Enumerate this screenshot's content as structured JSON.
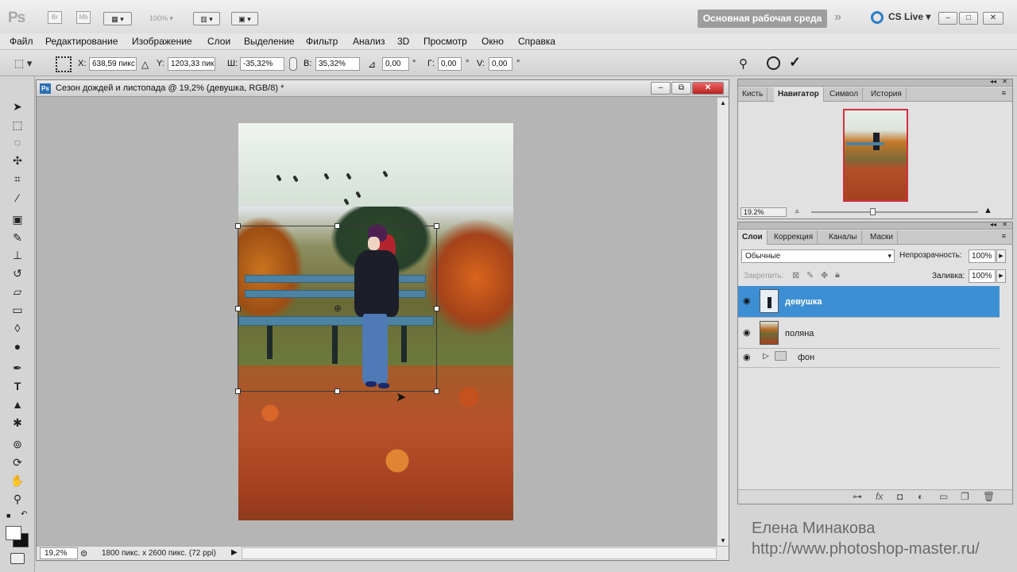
{
  "app": {
    "logo": "Ps",
    "br_label": "Br",
    "mb_label": "Mb",
    "zoom_display": "100%",
    "workspace_label": "Основная рабочая среда",
    "chevrons": "»",
    "cslive_label": "CS Live",
    "window_min": "–",
    "window_max": "□",
    "window_close": "✕"
  },
  "menu": [
    "Файл",
    "Редактирование",
    "Изображение",
    "Слои",
    "Выделение",
    "Фильтр",
    "Анализ",
    "3D",
    "Просмотр",
    "Окно",
    "Справка"
  ],
  "options": {
    "x_label": "X:",
    "x_value": "638,59 пикс",
    "y_label": "Y:",
    "y_value": "1203,33 пик",
    "w_label": "Ш:",
    "w_value": "-35,32%",
    "h_label": "В:",
    "h_value": "35,32%",
    "angle_value": "0,00",
    "g_label": "Г:",
    "g_value": "0,00",
    "v_label": "V:",
    "v_value": "0,00",
    "degree": "°"
  },
  "document": {
    "title": "Сезон дождей и листопада @ 19,2% (девушка, RGB/8) *",
    "zoom": "19,2%",
    "size_info": "1800 пикс. x 2600 пикс. (72 ppi)"
  },
  "navigator": {
    "tabs": [
      "Кисть",
      "Навигатор",
      "Символ",
      "История"
    ],
    "active_tab": "Навигатор",
    "zoom": "19.2%"
  },
  "layers": {
    "tabs": [
      "Слои",
      "Коррекция",
      "Каналы",
      "Маски"
    ],
    "active_tab": "Слои",
    "blend_mode": "Обычные",
    "opacity_label": "Непрозрачность:",
    "opacity_value": "100%",
    "lock_label": "Закрепить:",
    "fill_label": "Заливка:",
    "fill_value": "100%",
    "items": [
      {
        "name": "девушка",
        "selected": true
      },
      {
        "name": "поляна",
        "selected": false
      },
      {
        "name": "фон",
        "selected": false,
        "group": true
      }
    ]
  },
  "watermark": {
    "author": "Елена Минакова",
    "url": "http://www.photoshop-master.ru/"
  },
  "colors": {
    "selection": "#3d8fd4",
    "workspace_btn": "#9d9d9d",
    "close_btn": "#c9362c"
  }
}
